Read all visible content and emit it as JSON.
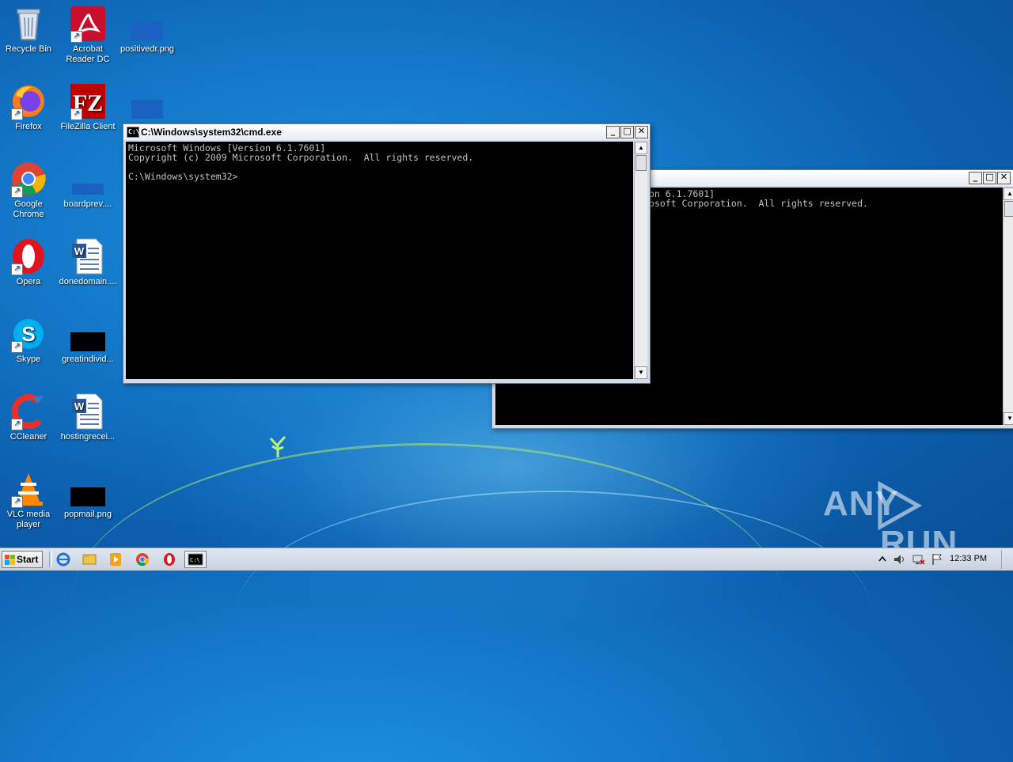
{
  "desktop": {
    "icons": [
      {
        "label": "Recycle Bin",
        "icon": "recycle-bin-icon"
      },
      {
        "label": "Acrobat Reader DC",
        "icon": "acrobat-icon"
      },
      {
        "label": "positivedr.png",
        "icon": "image-file-icon"
      },
      {
        "label": "Firefox",
        "icon": "firefox-icon"
      },
      {
        "label": "FileZilla Client",
        "icon": "filezilla-icon"
      },
      {
        "label": "Google Chrome",
        "icon": "chrome-icon"
      },
      {
        "label": "boardprev....",
        "icon": "file-icon"
      },
      {
        "label": "Opera",
        "icon": "opera-icon"
      },
      {
        "label": "donedomain....",
        "icon": "word-doc-icon"
      },
      {
        "label": "Skype",
        "icon": "skype-icon"
      },
      {
        "label": "greatindivid...",
        "icon": "image-file-icon"
      },
      {
        "label": "CCleaner",
        "icon": "ccleaner-icon"
      },
      {
        "label": "hostingrecei...",
        "icon": "word-doc-icon"
      },
      {
        "label": "VLC media player",
        "icon": "vlc-icon"
      },
      {
        "label": "popmail.png",
        "icon": "image-file-icon"
      }
    ]
  },
  "front_window": {
    "title": "C:\\Windows\\system32\\cmd.exe",
    "console_text": "Microsoft Windows [Version 6.1.7601]\nCopyright (c) 2009 Microsoft Corporation.  All rights reserved.\n\nC:\\Windows\\system32>",
    "buttons": {
      "minimize": "_",
      "maximize": "□",
      "close": "✕"
    }
  },
  "back_window": {
    "console_text": "on 6.1.7601]\nosoft Corporation.  All rights reserved.",
    "buttons": {
      "minimize": "_",
      "maximize": "□",
      "close": "✕"
    }
  },
  "watermark": {
    "left": "ANY",
    "right": "RUN"
  },
  "taskbar": {
    "start_label": "Start",
    "apps": [
      "ie-icon",
      "explorer-icon",
      "media-player-icon",
      "chrome-icon",
      "opera-icon",
      "cmd-icon"
    ],
    "clock": "12:33 PM"
  }
}
